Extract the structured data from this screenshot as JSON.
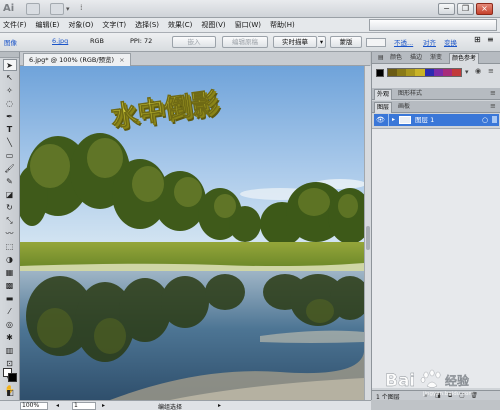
{
  "app": {
    "logo": "Ai"
  },
  "menu": {
    "items": [
      "文件(F)",
      "编辑(E)",
      "对象(O)",
      "文字(T)",
      "选择(S)",
      "效果(C)",
      "视图(V)",
      "窗口(W)",
      "帮助(H)"
    ]
  },
  "control_bar": {
    "object_type": "图像",
    "file_name": "6.jpg",
    "color_mode": "RGB",
    "ppi": "PPI: 72",
    "embed_button": "嵌入",
    "edit_original_button": "编辑原稿",
    "live_trace_button": "实时描摹",
    "mask_button": "蒙版",
    "opacity_link": "不透...",
    "align_link": "对齐",
    "transform_link": "变换"
  },
  "document": {
    "tab_title": "6.jpg* @ 100% (RGB/预览)",
    "close_symbol": "×",
    "artwork_text": "水中倒影"
  },
  "status_bar": {
    "zoom": "100%",
    "page": "1",
    "tool_status": "编组选择"
  },
  "top_panel": {
    "tabs": [
      "",
      "颜色",
      "描边",
      "渐变",
      "颜色参考"
    ],
    "active_tab": "颜色参考",
    "guide_colors": [
      "#6b5b14",
      "#8a7a18",
      "#a8961e",
      "#c9b327",
      "#2b2bb0",
      "#7a2ba8",
      "#a82b7a",
      "#c23a3a"
    ]
  },
  "mid_panel": {
    "tabs_a": [
      "外观",
      "图形样式"
    ],
    "tabs_b": [
      "图层",
      "画板"
    ],
    "layer_name": "图层 1",
    "layer_count": "1 个图层"
  },
  "watermark": {
    "brand": "Bai",
    "suffix": "经验",
    "url": "jingyan.baidu.com"
  },
  "colors": {
    "accent_blue": "#3a77d8",
    "title_gold": "#c9c62c",
    "sky_top": "#6fa3da",
    "water": "#3f6b8f"
  }
}
